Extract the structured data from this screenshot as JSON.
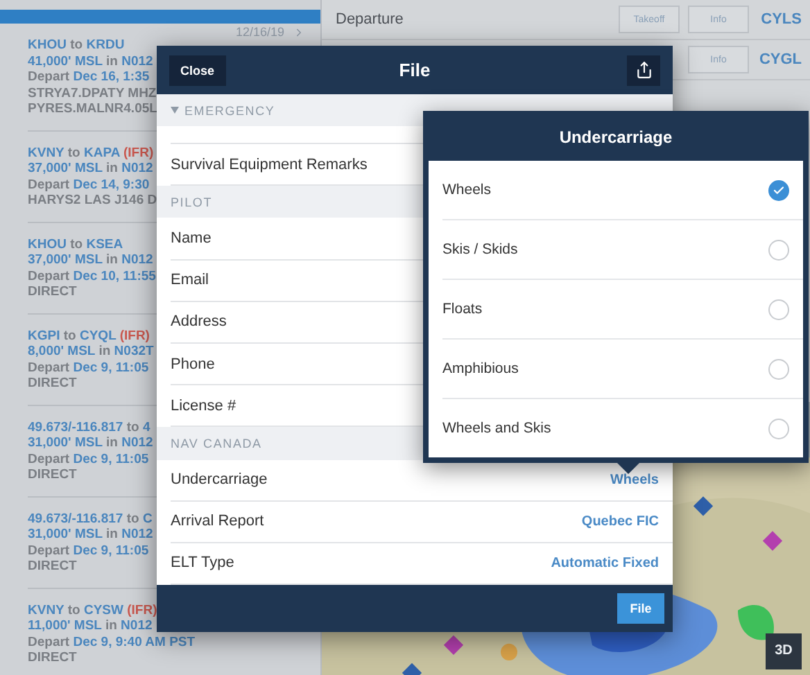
{
  "trip_list": [
    {
      "date": "12/16/19",
      "lines": [
        [
          {
            "text": "KHOU",
            "kind": "accent"
          },
          {
            "text": "to",
            "kind": "plain"
          },
          {
            "text": "KRDU",
            "kind": "accent"
          }
        ],
        [
          {
            "text": "41,000' MSL",
            "kind": "accent"
          },
          {
            "text": "in",
            "kind": "plain"
          },
          {
            "text": "N012",
            "kind": "accent"
          }
        ],
        [
          {
            "text": "Depart",
            "kind": "plain"
          },
          {
            "text": "Dec 16, 1:35",
            "kind": "accent"
          }
        ],
        [
          {
            "text": "STRYA7.DPATY MHZ",
            "kind": "plain"
          }
        ],
        [
          {
            "text": "PYRES.MALNR4.05L",
            "kind": "plain"
          }
        ]
      ]
    },
    {
      "lines": [
        [
          {
            "text": "KVNY",
            "kind": "accent"
          },
          {
            "text": "to",
            "kind": "plain"
          },
          {
            "text": "KAPA",
            "kind": "accent"
          },
          {
            "text": "(IFR)",
            "kind": "alert"
          }
        ],
        [
          {
            "text": "37,000' MSL",
            "kind": "accent"
          },
          {
            "text": "in",
            "kind": "plain"
          },
          {
            "text": "N012",
            "kind": "accent"
          }
        ],
        [
          {
            "text": "Depart",
            "kind": "plain"
          },
          {
            "text": "Dec 14, 9:30",
            "kind": "accent"
          }
        ],
        [
          {
            "text": "HARYS2 LAS J146 D",
            "kind": "plain"
          }
        ]
      ]
    },
    {
      "lines": [
        [
          {
            "text": "KHOU",
            "kind": "accent"
          },
          {
            "text": "to",
            "kind": "plain"
          },
          {
            "text": "KSEA",
            "kind": "accent"
          }
        ],
        [
          {
            "text": "37,000' MSL",
            "kind": "accent"
          },
          {
            "text": "in",
            "kind": "plain"
          },
          {
            "text": "N012",
            "kind": "accent"
          }
        ],
        [
          {
            "text": "Depart",
            "kind": "plain"
          },
          {
            "text": "Dec 10, 11:55",
            "kind": "accent"
          }
        ],
        [
          {
            "text": "DIRECT",
            "kind": "plain"
          }
        ]
      ]
    },
    {
      "lines": [
        [
          {
            "text": "KGPI",
            "kind": "accent"
          },
          {
            "text": "to",
            "kind": "plain"
          },
          {
            "text": "CYQL",
            "kind": "accent"
          },
          {
            "text": "(IFR)",
            "kind": "alert"
          }
        ],
        [
          {
            "text": "8,000' MSL",
            "kind": "accent"
          },
          {
            "text": "in",
            "kind": "plain"
          },
          {
            "text": "N032T",
            "kind": "accent"
          }
        ],
        [
          {
            "text": "Depart",
            "kind": "plain"
          },
          {
            "text": "Dec 9, 11:05",
            "kind": "accent"
          }
        ],
        [
          {
            "text": "DIRECT",
            "kind": "plain"
          }
        ]
      ]
    },
    {
      "lines": [
        [
          {
            "text": "49.673/-116.817",
            "kind": "accent"
          },
          {
            "text": "to",
            "kind": "plain"
          },
          {
            "text": "4",
            "kind": "accent"
          }
        ],
        [
          {
            "text": "31,000' MSL",
            "kind": "accent"
          },
          {
            "text": "in",
            "kind": "plain"
          },
          {
            "text": "N012",
            "kind": "accent"
          }
        ],
        [
          {
            "text": "Depart",
            "kind": "plain"
          },
          {
            "text": "Dec 9, 11:05",
            "kind": "accent"
          }
        ],
        [
          {
            "text": "DIRECT",
            "kind": "plain"
          }
        ]
      ]
    },
    {
      "lines": [
        [
          {
            "text": "49.673/-116.817",
            "kind": "accent"
          },
          {
            "text": "to",
            "kind": "plain"
          },
          {
            "text": "C",
            "kind": "accent"
          }
        ],
        [
          {
            "text": "31,000' MSL",
            "kind": "accent"
          },
          {
            "text": "in",
            "kind": "plain"
          },
          {
            "text": "N012",
            "kind": "accent"
          }
        ],
        [
          {
            "text": "Depart",
            "kind": "plain"
          },
          {
            "text": "Dec 9, 11:05",
            "kind": "accent"
          }
        ],
        [
          {
            "text": "DIRECT",
            "kind": "plain"
          }
        ]
      ]
    },
    {
      "lines": [
        [
          {
            "text": "KVNY",
            "kind": "accent"
          },
          {
            "text": "to",
            "kind": "plain"
          },
          {
            "text": "CYSW",
            "kind": "accent"
          },
          {
            "text": "(IFR)",
            "kind": "alert"
          }
        ],
        [
          {
            "text": "11,000' MSL",
            "kind": "accent"
          },
          {
            "text": "in",
            "kind": "plain"
          },
          {
            "text": "N012",
            "kind": "accent"
          }
        ],
        [
          {
            "text": "Depart",
            "kind": "plain"
          },
          {
            "text": "Dec 9, 9:40 AM PST",
            "kind": "accent"
          }
        ],
        [
          {
            "text": "DIRECT",
            "kind": "plain"
          }
        ]
      ]
    }
  ],
  "departure": {
    "label": "Departure",
    "rows": [
      {
        "buttons": [
          "Takeoff",
          "Info"
        ],
        "airport": "CYLS"
      },
      {
        "buttons": [
          "Info"
        ],
        "airport": "CYGL"
      }
    ]
  },
  "map": {
    "kind": "picture",
    "button": "3D"
  },
  "file_dialog": {
    "close": "Close",
    "title": "File",
    "sections": [
      {
        "title": "EMERGENCY",
        "kind": "disclosure",
        "rows": [
          {
            "label": "Survival Equipment Remarks"
          }
        ]
      },
      {
        "title": "PILOT",
        "kind": "plain",
        "rows": [
          {
            "label": "Name"
          },
          {
            "label": "Email"
          },
          {
            "label": "Address"
          },
          {
            "label": "Phone"
          },
          {
            "label": "License #"
          }
        ]
      },
      {
        "title": "NAV CANADA",
        "kind": "plain",
        "rows": [
          {
            "label": "Undercarriage",
            "value": "Wheels"
          },
          {
            "label": "Arrival Report",
            "value": "Quebec FIC"
          },
          {
            "label": "ELT Type",
            "value": "Automatic Fixed"
          }
        ]
      }
    ],
    "submit": "File"
  },
  "undercarriage_popover": {
    "title": "Undercarriage",
    "options": [
      {
        "label": "Wheels",
        "selected": true
      },
      {
        "label": "Skis / Skids",
        "selected": false
      },
      {
        "label": "Floats",
        "selected": false
      },
      {
        "label": "Amphibious",
        "selected": false
      },
      {
        "label": "Wheels and Skis",
        "selected": false
      }
    ]
  }
}
